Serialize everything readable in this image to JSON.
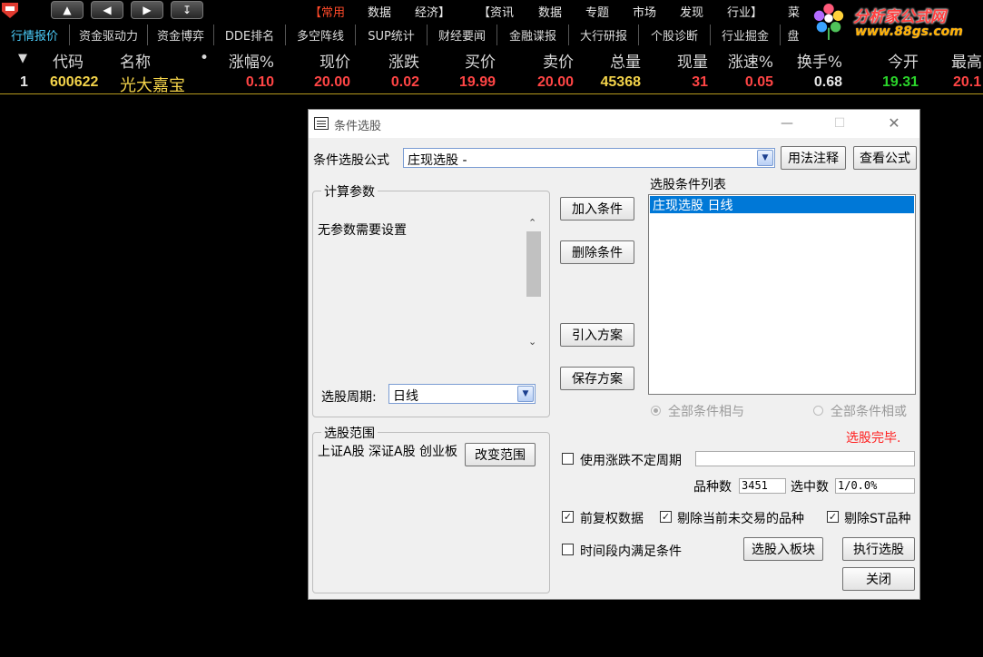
{
  "toolbar": {
    "menus_red_left": "【常用",
    "menus": [
      "数据",
      "经济】",
      "【资讯",
      "数据",
      "专题",
      "市场",
      "发现",
      "行业】",
      "菜"
    ],
    "brand_name": "分析家公式网",
    "brand_url": "www.88gs.com"
  },
  "tabs": [
    "行情报价",
    "资金驱动力",
    "资金博弈",
    "DDE排名",
    "多空阵线",
    "SUP统计",
    "财经要闻",
    "金融谍报",
    "大行研报",
    "个股诊断",
    "行业掘金",
    "盘"
  ],
  "grid": {
    "headers": [
      "代码",
      "名称",
      "•",
      "涨幅%",
      "现价",
      "涨跌",
      "买价",
      "卖价",
      "总量",
      "现量",
      "涨速%",
      "换手%",
      "今开",
      "最高"
    ],
    "row": {
      "index": "1",
      "code": "600622",
      "name": "光大嘉宝",
      "change_pct": "0.10",
      "price": "20.00",
      "change": "0.02",
      "bid": "19.99",
      "ask": "20.00",
      "volume": "45368",
      "cur_volume": "31",
      "speed": "0.05",
      "turnover": "0.68",
      "open": "19.31",
      "high": "20.1"
    }
  },
  "dialog": {
    "title": "条件选股",
    "formula_label": "条件选股公式",
    "formula_value": "庄现选股       -",
    "usage_button": "用法注释",
    "view_formula_button": "查看公式",
    "params_group_title": "计算参数",
    "params_text": "无参数需要设置",
    "period_label": "选股周期:",
    "period_value": "日线",
    "condition_list_title": "选股条件列表",
    "conditions": [
      "庄现选股   日线"
    ],
    "add_condition": "加入条件",
    "delete_condition": "删除条件",
    "import_scheme": "引入方案",
    "save_scheme": "保存方案",
    "radio_and": "全部条件相与",
    "radio_or": "全部条件相或",
    "status": "选股完毕.",
    "range_group_title": "选股范围",
    "range_text": "上证A股 深证A股 创业板",
    "change_range": "改变范围",
    "use_uncertain_period": "使用涨跌不定周期",
    "count_label": "品种数",
    "count_value": "3451",
    "selected_label": "选中数",
    "selected_value": "1/0.0%",
    "forward_adjust": "前复权数据",
    "exclude_untraded": "剔除当前未交易的品种",
    "exclude_st": "剔除ST品种",
    "time_range": "时间段内满足条件",
    "to_block": "选股入板块",
    "execute": "执行选股",
    "close": "关闭"
  },
  "colors": {
    "up_red": "#ff4545",
    "green": "#2bd52b",
    "code_yellow": "#f3d34a",
    "active_tab": "#4dd0ff",
    "selection_blue": "#0078d7"
  }
}
